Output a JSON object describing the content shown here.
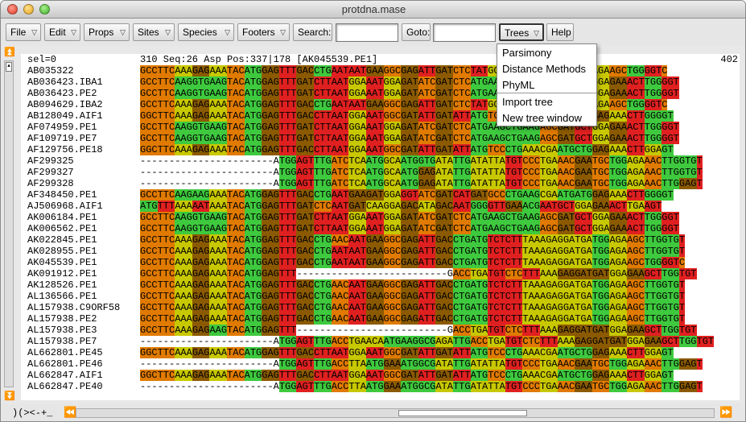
{
  "window": {
    "title": "protdna.mase"
  },
  "toolbar": {
    "file": "File",
    "edit": "Edit",
    "props": "Props",
    "sites": "Sites",
    "species": "Species",
    "footers": "Footers",
    "search_label": "Search:",
    "search_value": "",
    "goto_label": "Goto:",
    "goto_value": "",
    "trees": "Trees",
    "help": "Help",
    "dropdown_icon": "chevron-down-icon"
  },
  "trees_menu": {
    "items": [
      "Parsimony",
      "Distance Methods",
      "PhyML",
      "Import tree",
      "New tree window"
    ]
  },
  "header": {
    "sel": "sel=0",
    "info": "310   Seq:26 Asp Pos:337|178 [AK045539.PE1]",
    "end_pos": "402"
  },
  "sequences": [
    {
      "name": "AB035322",
      "seq": "GCCTTCAAAGAGAAATACATGGAGTTTGACCTGAATAATGAAGGCGAGATTGATCTCTATGGAGCTGATTGATGGCTGAGAAGCTGGGGTC"
    },
    {
      "name": "AB036423.IBA1",
      "seq": "GCCTTCAAGGTGAAGTACATGGAGTTTGATCTTAATGGAAATGGAGATATCGATCTCATGAAGCTGAAGAGCGATGCTGGAGAAACTTGGGGT"
    },
    {
      "name": "AB036423.PE2",
      "seq": "GCCTTCAAGGTGAAGTACATGGAGTTTGATCTTAATGGAAATGGAGATATCGATCTCATGAAGCTGAAGAGCGATGCTGGAGAAACTTGGGGT"
    },
    {
      "name": "AB094629.IBA2",
      "seq": "GCCTTCAAAGAGAAATACATGGAGTTTGACCTGAATAATGAAGGCGAGATTGATCTCTATGGAGCTGATTGATGGCTGAGAAGCTGGGGTC"
    },
    {
      "name": "AB128049.AIF1",
      "seq": "GGCTTCAAAGAGAAATACATGGAGTTTGACCTTAATGGAAATGGCGATATTGATATTATGTCCCTGAAACGAATGCTGGAGAAACTTGGGGT"
    },
    {
      "name": "AF074959.PE1",
      "seq": "GCCTTCAAGGTGAAGTACATGGAGTTTGATCTTAATGGAAATGGAGATATCGATCTCATGAAGCTGAAGAGCGATGCTGGAGAAACTTGGGGT"
    },
    {
      "name": "AF109719.PE7",
      "seq": "GCCTTCAAGGTGAAGTACATGGAGTTTGATCTTAATGGAAATGGAGATATCGATCTCATGAAGCTGAAGAGCGATGCTGGAGAAACTTGGGGT"
    },
    {
      "name": "AF129756.PE18",
      "seq": "GGCTTCAAAGAGAAATACATGGAGTTTGACCTTAATGGAAATGGCGATATTGATATTATGTCCCTGAAACGAATGCTGGAGAAACTTGGAGT"
    },
    {
      "name": "AF299325",
      "seq": "-----------------------ATGGAGTTTGATCTCAATGGCAATGGTGATATTGATATTATGTCCCTGAAACGAATGCTGGAGAAACTTGGTGT"
    },
    {
      "name": "AF299327",
      "seq": "-----------------------ATGGAGTTTGATCTCAATGGCAATGGAGATATTGATATTATGTCCCTGAAACGAATGCTGGAGAAACTTGGTGT"
    },
    {
      "name": "AF299328",
      "seq": "-----------------------ATGGAGTTTGATCTCAATGGCAATGGAGATATTGATATTATGTCCCTGAAACGAATGCTGGAGAAACTTGGAGT"
    },
    {
      "name": "AF348450.PE1",
      "seq": "GCCTTCAAGAAGAAATACATGGAGTTTGACCTGAATGAAGATGGAGGTATCGATCATGATGCCCTGAAGCGAATGATGGAGAAACTTGGGGT"
    },
    {
      "name": "AJ506968.AIF1",
      "seq": "ATGTTTAAAAATAAATACATGGAGTTTGATCTCAATGATCAAGGAGACATAGACAATGGGGTTGAAACGAATGCTGGAGAAACTTGAAGT"
    },
    {
      "name": "AK006184.PE1",
      "seq": "GCCTTCAAGGTGAAGTACATGGAGTTTGATCTTAATGGAAATGGAGATATCGATCTCATGAAGCTGAAGAGCGATGCTGGAGAAACTTGGGGT"
    },
    {
      "name": "AK006562.PE1",
      "seq": "GCCTTCAAGGTGAAGTACATGGAGTTTGATCTTAATGGAAATGGAGATATCGATCTCATGAAGCTGAAGAGCGATGCTGGAGAAACTTGGGGT"
    },
    {
      "name": "AK022845.PE1",
      "seq": "GCCTTCAAAGAGAAATACATGGAGTTTGACCTGAACAATGAAGGCGAGATTGACCTGATGTCTCTTTAAAGAGGATGATGGAGAAGCTTGGTGT"
    },
    {
      "name": "AK028955.PE1",
      "seq": "GCCTTCAAAGAGAAATACATGGAGTTTGACCTGAATAATGAAGGCGAGATTGACCTGATGTCTCTTTAAAGAGGATGATGGAGAAGCTTGGTGT"
    },
    {
      "name": "AK045539.PE1",
      "seq": "GCCTTCAAAGAGAAATACATGGAGTTTGACCTGAATAATGAAGGCGAGATTGACCTGATGTCTCTTTAAAGAGGATGATGGAGAAGCTGGGGTC"
    },
    {
      "name": "AK091912.PE1",
      "seq": "GCCTTCAAAGAGAAATACATGGAGTTT--------------------------GACCTGATGTCTCTTTAAAGAGGATGATGGAGAAGCTTGGTGT"
    },
    {
      "name": "AK128526.PE1",
      "seq": "GCCTTCAAAGAGAAATACATGGAGTTTGACCTGAACAATGAAGGCGAGATTGACCTGATGTCTCTTTAAAGAGGATGATGGAGAAGCTTGGTGT"
    },
    {
      "name": "AL136566.PE1",
      "seq": "GCCTTCAAAGAGAAATACATGGAGTTTGACCTGAACAATGAAGGCGAGATTGACCTGATGTCTCTTTAAAGAGGATGATGGAGAAGCTTGGTGT"
    },
    {
      "name": "AL157938.C9ORF58",
      "seq": "GCCTTCAAAGAGAAATACATGGAGTTTGACCTGAACAATGAAGGCGAGATTGACCTGATGTCTCTTTAAAGAGGATGATGGAGAAGCTTGGTGT"
    },
    {
      "name": "AL157938.PE2",
      "seq": "GCCTTCAAAGAGAAATACATGGAGTTTGACCTGAACAATGAAGGCGAGATTGACCTGATGTCTCTTTAAAGAGGATGATGGAGAAGCTTGGTGT"
    },
    {
      "name": "AL157938.PE3",
      "seq": "GCCTTCAAAGAGAAGTACATGGAGTTT--------------------------GACCTGATGTCTCTTTAAAGAGGATGATGGAGAAGCTTGGTGT"
    },
    {
      "name": "AL157938.PE7",
      "seq": "-----------------------ATGGAGTTTGACCTGAACAATGAAGGCGAGATTGACCTGATGTCTCTTTAAAGAGGATGATGGAGAAGCTTGGTGT"
    },
    {
      "name": "AL662801.PE45",
      "seq": "GGCTTCAAAGAGAAATACATGGAGTTTGACCTTAATGGAAATGGCGATATTGATATTATGTCCCTGAAACGAATGCTGGAGAAACTTGGAGT"
    },
    {
      "name": "AL662801.PE46",
      "seq": "-----------------------ATGGAGTTTGACCTTAATGGAAATGGCGATATTGATATTATGTCCCTGAAACGAATGCTGGAGAAACTTGGAGT"
    },
    {
      "name": "AL662847.AIF1",
      "seq": "GGCTTCAAAGAGAAATACATGGAGTTTGACCTTAATGGAAATGGCGATATTGATATTATGTCCCTGAAACGAATGCTGGAGAAACTTGGAGT"
    },
    {
      "name": "AL662847.PE40",
      "seq": "-----------------------ATGGAGTTTGACCTTAATGGAAATGGCGATATTGATATTATGTCCCTGAAACGAATGCTGGAGAAACTTGGAGT"
    }
  ],
  "codon_colors": {
    "G": "#3ec93e",
    "A": "#c8c800",
    "C": "#e07a00",
    "T": "#e02020",
    "dark": "#8b5a00",
    "gap": "#ffffff"
  },
  "footer": {
    "status": ")(><-+_"
  }
}
